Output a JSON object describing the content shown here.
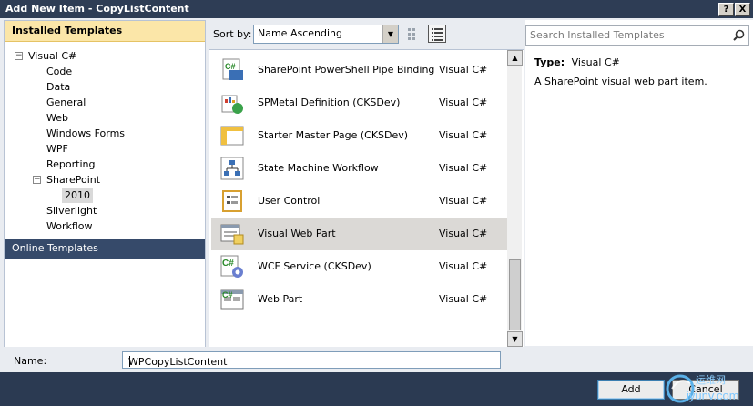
{
  "window": {
    "title": "Add New Item - CopyListContent",
    "help_glyph": "?",
    "close_glyph": "X"
  },
  "left_panel": {
    "installed_header": "Installed Templates",
    "tree": {
      "visual_csharp": "Visual C#",
      "code": "Code",
      "data": "Data",
      "general": "General",
      "web": "Web",
      "windows_forms": "Windows Forms",
      "wpf": "WPF",
      "reporting": "Reporting",
      "sharepoint": "SharePoint",
      "sp2010": "2010",
      "silverlight": "Silverlight",
      "workflow": "Workflow",
      "expand_glyph": "−"
    },
    "online_header": "Online Templates"
  },
  "toolbar": {
    "sort_label": "Sort by:",
    "sort_value": "Name Ascending",
    "dropdown_glyph": "▼"
  },
  "templates": [
    {
      "name": "SharePoint PowerShell Pipe Binding (CK...",
      "language": "Visual C#",
      "icon": "powershell-binding-icon"
    },
    {
      "name": "SPMetal Definition (CKSDev)",
      "language": "Visual C#",
      "icon": "spmetal-icon"
    },
    {
      "name": "Starter Master Page (CKSDev)",
      "language": "Visual C#",
      "icon": "master-page-icon"
    },
    {
      "name": "State Machine Workflow",
      "language": "Visual C#",
      "icon": "state-machine-icon"
    },
    {
      "name": "User Control",
      "language": "Visual C#",
      "icon": "user-control-icon"
    },
    {
      "name": "Visual Web Part",
      "language": "Visual C#",
      "icon": "visual-web-part-icon"
    },
    {
      "name": "WCF Service (CKSDev)",
      "language": "Visual C#",
      "icon": "wcf-service-icon"
    },
    {
      "name": "Web Part",
      "language": "Visual C#",
      "icon": "web-part-icon"
    }
  ],
  "selected_template": "Visual Web Part",
  "scrollbar": {
    "up_glyph": "▲",
    "down_glyph": "▼"
  },
  "details": {
    "search_placeholder": "Search Installed Templates",
    "type_label": "Type:",
    "type_value": "Visual C#",
    "description": "A SharePoint visual web part item."
  },
  "name_field": {
    "label": "Name:",
    "value": "WPCopyListContent"
  },
  "buttons": {
    "add": "Add",
    "cancel": "Cancel"
  },
  "watermark": {
    "text": "iyunv.com",
    "cn_text": "运维网"
  },
  "colors": {
    "title_bar": "#2e3d55",
    "installed_header": "#fbe6a8",
    "online_header": "#364a6a",
    "selection": "#dbd9d6",
    "footer": "#2b3a52"
  }
}
